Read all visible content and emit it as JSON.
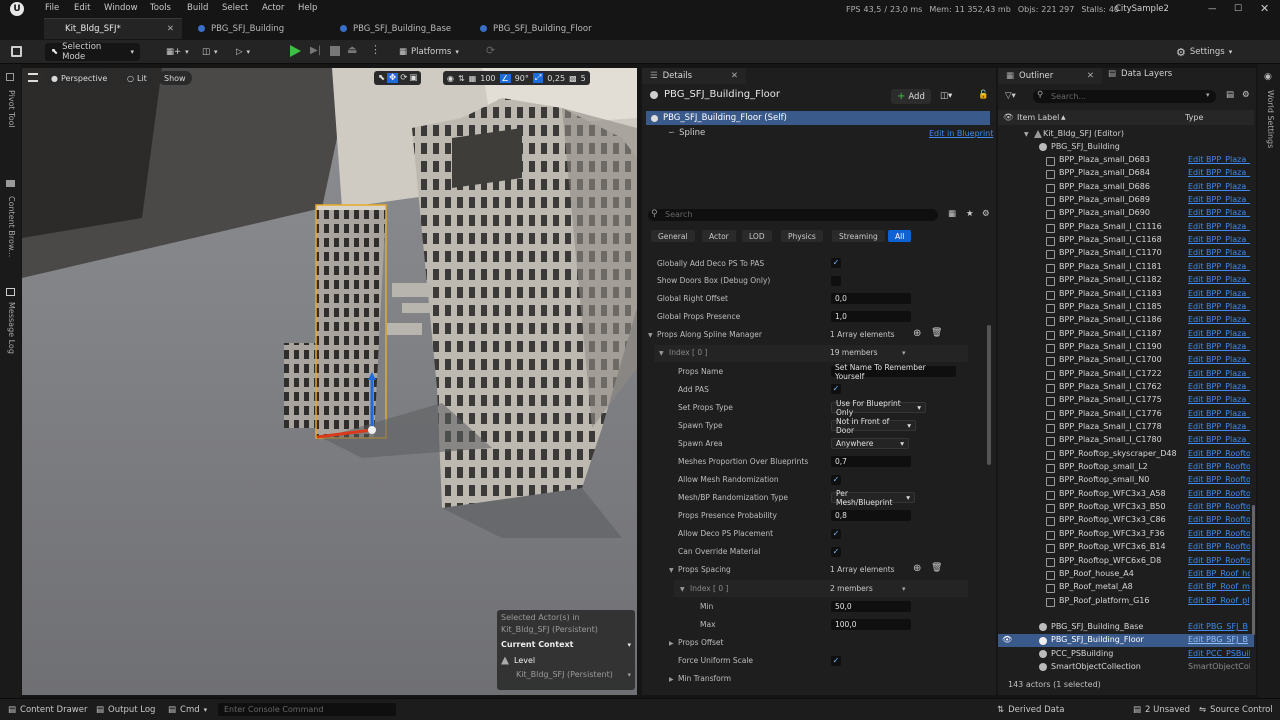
{
  "menu": [
    "File",
    "Edit",
    "Window",
    "Tools",
    "Build",
    "Select",
    "Actor",
    "Help"
  ],
  "stats": {
    "fps_label": "FPS",
    "fps": "43,5",
    "ms": "23,0 ms",
    "mem_label": "Mem:",
    "mem": "11 352,43 mb",
    "objs_label": "Objs:",
    "objs": "221 297",
    "stalls_label": "Stalls:",
    "stalls": "40"
  },
  "project_name": "CitySample2",
  "tabs": [
    "Kit_Bldg_SFJ*",
    "PBG_SFJ_Building",
    "PBG_SFJ_Building_Base",
    "PBG_SFJ_Building_Floor"
  ],
  "toolbar": {
    "save": "save-icon",
    "selection_mode": "Selection Mode",
    "platforms": "Platforms",
    "settings": "Settings"
  },
  "left_strip": [
    "Pivot Tool",
    "Content Brow...",
    "Message Log"
  ],
  "right_strip": [
    "World Settings"
  ],
  "viewport": {
    "perspective": "Perspective",
    "lit": "Lit",
    "show": "Show",
    "grid_snap": "100",
    "rotation_snap": "90°",
    "scale_snap": "0,25",
    "camera_speed": "5",
    "overlay": {
      "selected_actors": "Selected Actor(s) in",
      "selected_level": "Kit_Bldg_SFJ (Persistent)",
      "current_context": "Current Context",
      "level_label": "Level",
      "level_value": "Kit_Bldg_SFJ (Persistent)"
    }
  },
  "details": {
    "tab": "Details",
    "actor_name": "PBG_SFJ_Building_Floor",
    "add": "Add",
    "self_row": "PBG_SFJ_Building_Floor (Self)",
    "spline_row": "Spline",
    "edit_bp": "Edit in Blueprint",
    "search_placeholder": "Search",
    "categories": [
      "General",
      "Actor",
      "LOD",
      "Physics",
      "Streaming",
      "All"
    ]
  },
  "props": [
    {
      "label": "Globally Add Deco PS To PAS",
      "check": true
    },
    {
      "label": "Show Doors Box (Debug Only)",
      "check": false
    },
    {
      "label": "Global Right Offset",
      "value": "0,0"
    },
    {
      "label": "Global Props Presence",
      "value": "1,0"
    },
    {
      "label": "Props Along Spline Manager",
      "text": "1 Array elements"
    },
    {
      "label": "Index [ 0 ]",
      "text": "19 members"
    },
    {
      "label": "Props Name",
      "value": "Set Name To Remember Yourself"
    },
    {
      "label": "Add PAS",
      "check": true
    },
    {
      "label": "Set Props Type",
      "drop": "Use For Blueprint Only"
    },
    {
      "label": "Spawn Type",
      "drop": "Not in Front of Door"
    },
    {
      "label": "Spawn Area",
      "drop": "Anywhere"
    },
    {
      "label": "Meshes Proportion Over Blueprints",
      "value": "0,7"
    },
    {
      "label": "Allow Mesh Randomization",
      "check": true
    },
    {
      "label": "Mesh/BP Randomization Type",
      "drop": "Per Mesh/Blueprint"
    },
    {
      "label": "Props Presence Probability",
      "value": "0,8"
    },
    {
      "label": "Allow Deco PS Placement",
      "check": true
    },
    {
      "label": "Can Override Material",
      "check": true
    },
    {
      "label": "Props Spacing",
      "text": "1 Array elements"
    },
    {
      "label": "Index [ 0 ]",
      "text": "2 members"
    },
    {
      "label": "Min",
      "value": "50,0"
    },
    {
      "label": "Max",
      "value": "100,0"
    },
    {
      "label": "Props Offset"
    },
    {
      "label": "Force Uniform Scale",
      "check": true
    },
    {
      "label": "Min Transform"
    }
  ],
  "outliner": {
    "tab": "Outliner",
    "tab2": "Data Layers",
    "search_placeholder": "Search...",
    "col_label": "Item Label",
    "col_type": "Type",
    "root": "Kit_Bldg_SFJ (Editor)",
    "folder": "PBG_SFJ_Building",
    "items": [
      {
        "name": "BPP_Plaza_small_D683",
        "type": "Edit BPP_Plaza_"
      },
      {
        "name": "BPP_Plaza_small_D684",
        "type": "Edit BPP_Plaza_"
      },
      {
        "name": "BPP_Plaza_small_D686",
        "type": "Edit BPP_Plaza_"
      },
      {
        "name": "BPP_Plaza_small_D689",
        "type": "Edit BPP_Plaza_"
      },
      {
        "name": "BPP_Plaza_small_D690",
        "type": "Edit BPP_Plaza_"
      },
      {
        "name": "BPP_Plaza_Small_I_C1116",
        "type": "Edit BPP_Plaza_"
      },
      {
        "name": "BPP_Plaza_Small_I_C1168",
        "type": "Edit BPP_Plaza_"
      },
      {
        "name": "BPP_Plaza_Small_I_C1170",
        "type": "Edit BPP_Plaza_"
      },
      {
        "name": "BPP_Plaza_Small_I_C1181",
        "type": "Edit BPP_Plaza_"
      },
      {
        "name": "BPP_Plaza_Small_I_C1182",
        "type": "Edit BPP_Plaza_"
      },
      {
        "name": "BPP_Plaza_Small_I_C1183",
        "type": "Edit BPP_Plaza_"
      },
      {
        "name": "BPP_Plaza_Small_I_C1185",
        "type": "Edit BPP_Plaza_"
      },
      {
        "name": "BPP_Plaza_Small_I_C1186",
        "type": "Edit BPP_Plaza_"
      },
      {
        "name": "BPP_Plaza_Small_I_C1187",
        "type": "Edit BPP_Plaza_"
      },
      {
        "name": "BPP_Plaza_Small_I_C1190",
        "type": "Edit BPP_Plaza_"
      },
      {
        "name": "BPP_Plaza_Small_I_C1700",
        "type": "Edit BPP_Plaza_"
      },
      {
        "name": "BPP_Plaza_Small_I_C1722",
        "type": "Edit BPP_Plaza_"
      },
      {
        "name": "BPP_Plaza_Small_I_C1762",
        "type": "Edit BPP_Plaza_"
      },
      {
        "name": "BPP_Plaza_Small_I_C1775",
        "type": "Edit BPP_Plaza_"
      },
      {
        "name": "BPP_Plaza_Small_I_C1776",
        "type": "Edit BPP_Plaza_"
      },
      {
        "name": "BPP_Plaza_Small_I_C1778",
        "type": "Edit BPP_Plaza_"
      },
      {
        "name": "BPP_Plaza_Small_I_C1780",
        "type": "Edit BPP_Plaza_"
      },
      {
        "name": "BPP_Rooftop_skyscraper_D48",
        "type": "Edit BPP_Roofto"
      },
      {
        "name": "BPP_Rooftop_small_L2",
        "type": "Edit BPP_Roofto"
      },
      {
        "name": "BPP_Rooftop_small_N0",
        "type": "Edit BPP_Roofto"
      },
      {
        "name": "BPP_Rooftop_WFC3x3_A58",
        "type": "Edit BPP_Roofto"
      },
      {
        "name": "BPP_Rooftop_WFC3x3_B50",
        "type": "Edit BPP_Roofto"
      },
      {
        "name": "BPP_Rooftop_WFC3x3_C86",
        "type": "Edit BPP_Roofto"
      },
      {
        "name": "BPP_Rooftop_WFC3x3_F36",
        "type": "Edit BPP_Roofto"
      },
      {
        "name": "BPP_Rooftop_WFC3x6_B14",
        "type": "Edit BPP_Roofto"
      },
      {
        "name": "BPP_Rooftop_WFC6x6_D8",
        "type": "Edit BPP_Roofto"
      },
      {
        "name": "BP_Roof_house_A4",
        "type": "Edit BP_Roof_ho"
      },
      {
        "name": "BP_Roof_metal_A8",
        "type": "Edit BP_Roof_m"
      },
      {
        "name": "BP_Roof_platform_G16",
        "type": "Edit BP_Roof_pl"
      }
    ],
    "base": {
      "name": "PBG_SFJ_Building_Base",
      "type": "Edit PBG_SFJ_B"
    },
    "floor": {
      "name": "PBG_SFJ_Building_Floor",
      "type": "Edit PBG_SFJ_B"
    },
    "pcc": {
      "name": "PCC_PSBuilding",
      "type": "Edit PCC_PSBuil"
    },
    "smart": {
      "name": "SmartObjectCollection",
      "type": "SmartObjectColl"
    },
    "count": "143 actors (1 selected)"
  },
  "status": {
    "content_drawer": "Content Drawer",
    "output_log": "Output Log",
    "cmd": "Cmd",
    "console_placeholder": "Enter Console Command",
    "derived_data": "Derived Data",
    "unsaved": "2 Unsaved",
    "source_control": "Source Control"
  }
}
